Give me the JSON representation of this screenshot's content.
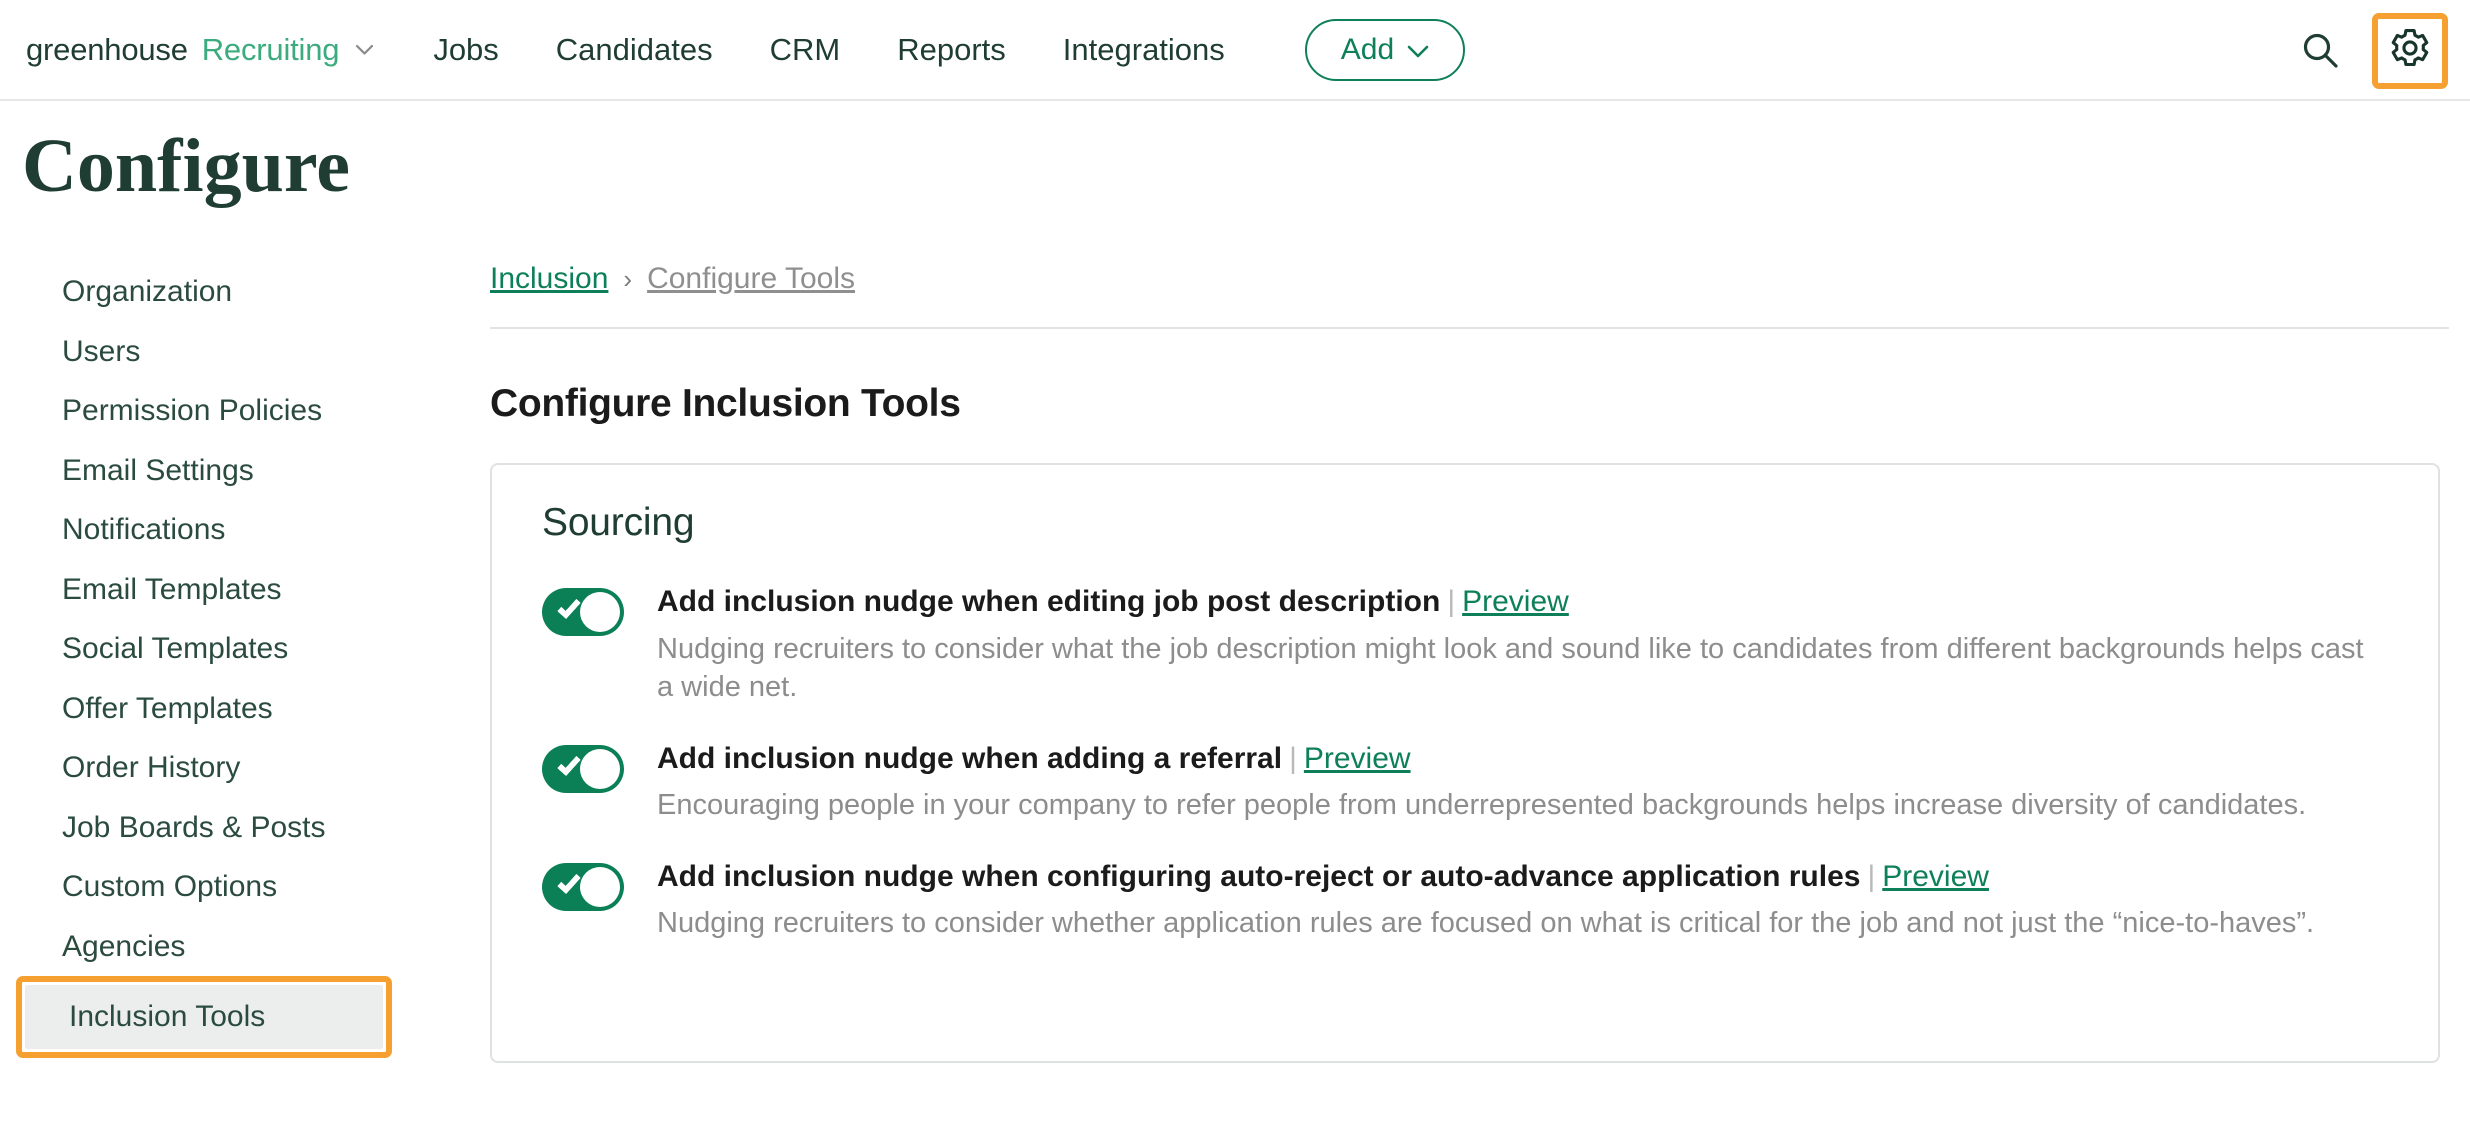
{
  "header": {
    "brand_primary": "greenhouse",
    "brand_secondary": "Recruiting",
    "brand_chevron_icon": "chevron-down-icon",
    "nav": [
      {
        "label": "Jobs"
      },
      {
        "label": "Candidates"
      },
      {
        "label": "CRM"
      },
      {
        "label": "Reports"
      },
      {
        "label": "Integrations"
      }
    ],
    "add_button": {
      "label": "Add",
      "icon": "chevron-down-icon"
    },
    "search_icon": "search-icon",
    "settings_icon": "gear-icon",
    "accent_green": "#0e8059",
    "highlight_orange": "#f5a030"
  },
  "page": {
    "title": "Configure"
  },
  "sidebar": {
    "items": [
      {
        "label": "Organization",
        "active": false
      },
      {
        "label": "Users",
        "active": false
      },
      {
        "label": "Permission Policies",
        "active": false
      },
      {
        "label": "Email Settings",
        "active": false
      },
      {
        "label": "Notifications",
        "active": false
      },
      {
        "label": "Email Templates",
        "active": false
      },
      {
        "label": "Social Templates",
        "active": false
      },
      {
        "label": "Offer Templates",
        "active": false
      },
      {
        "label": "Order History",
        "active": false
      },
      {
        "label": "Job Boards & Posts",
        "active": false
      },
      {
        "label": "Custom Options",
        "active": false
      },
      {
        "label": "Agencies",
        "active": false
      },
      {
        "label": "Inclusion Tools",
        "active": true
      }
    ]
  },
  "main": {
    "breadcrumb": {
      "parent": "Inclusion",
      "separator": "›",
      "current": "Configure Tools"
    },
    "heading": "Configure Inclusion Tools",
    "card": {
      "title": "Sourcing",
      "rows": [
        {
          "enabled": true,
          "title": "Add inclusion nudge when editing job post description",
          "separator": "|",
          "link": "Preview",
          "description": "Nudging recruiters to consider what the job description might look and sound like to candidates from different backgrounds helps cast a wide net."
        },
        {
          "enabled": true,
          "title": "Add inclusion nudge when adding a referral",
          "separator": "|",
          "link": "Preview",
          "description": "Encouraging people in your company to refer people from underrepresented backgrounds helps increase diversity of candidates."
        },
        {
          "enabled": true,
          "title": "Add inclusion nudge when configuring auto-reject or auto-advance application rules",
          "separator": "|",
          "link": "Preview",
          "description": "Nudging recruiters to consider whether application rules are focused on what is critical for the job and not just the “nice-to-haves”."
        }
      ]
    }
  }
}
